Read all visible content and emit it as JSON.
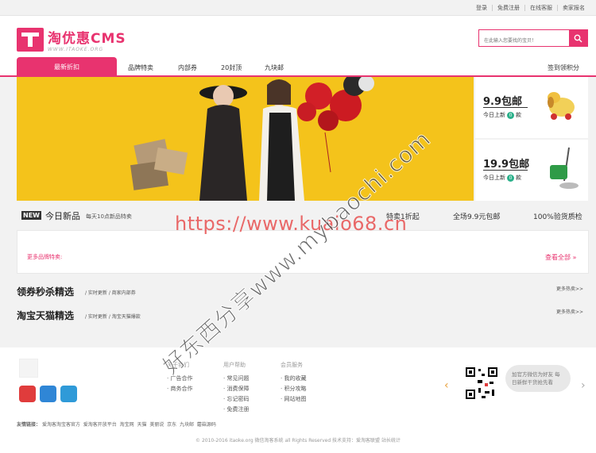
{
  "topbar": {
    "links": [
      "登录",
      "免费注册",
      "在线客服",
      "卖家报名"
    ]
  },
  "logo": {
    "title": "淘优惠CMS",
    "subtitle": "WWW.ITAOKE.ORG"
  },
  "search": {
    "placeholder": "在此输入您要找的宝贝！"
  },
  "nav": {
    "active": "最新折扣",
    "items": [
      "品牌特卖",
      "内部券",
      "20封顶",
      "九块邮"
    ],
    "right": "签到领积分"
  },
  "side": [
    {
      "price": "9.9包邮",
      "sub": "今日上新",
      "count": "0",
      "unit": "款"
    },
    {
      "price": "19.9包邮",
      "sub": "今日上新",
      "count": "0",
      "unit": "款"
    }
  ],
  "strip": {
    "badge": "NEW",
    "title": "今日新品",
    "sub": "每天10点新品特卖",
    "features": [
      "特卖1折起",
      "全场9.9元包邮",
      "100%验货质检"
    ]
  },
  "brand_panel": {
    "left": "更多品牌特卖:",
    "right": "查看全部 »"
  },
  "sections": [
    {
      "title": "领券秒杀精选",
      "sub": "/ 实时更新 / 商家内部券",
      "more": "更多热卖>>"
    },
    {
      "title": "淘宝天猫精选",
      "sub": "/ 实时更新 / 淘宝天猫爆款",
      "more": "更多热卖>>"
    }
  ],
  "footer": {
    "cols": [
      {
        "head": "关于我们",
        "items": [
          "广告合作",
          "商务合作"
        ]
      },
      {
        "head": "用户帮助",
        "items": [
          "常见问题",
          "消费保障",
          "忘记密码",
          "免费注册"
        ]
      },
      {
        "head": "会员服务",
        "items": [
          "我的收藏",
          "积分攻略",
          "网站地图"
        ]
      }
    ],
    "qr_text": "加官方微信为好友 每日新鲜干货抢先看",
    "friend_label": "友情链接：",
    "friends": [
      "爱淘客淘宝客官方",
      "爱淘客开放平台",
      "淘宝网",
      "天猫",
      "美丽说",
      "京东",
      "九块邮",
      "蘑菇源码"
    ],
    "copyright": "© 2010-2016 itaoke.org 微信淘客系统 all Rights Reserved 技术支持：爱淘客联盟 站长统计"
  },
  "watermarks": {
    "url": "https://www.kuaio68.cn",
    "diag": "好东西分享www.mybaochi.com"
  },
  "colors": {
    "accent": "#e8336f",
    "banner": "#f4c31b",
    "green": "#2ab08a"
  }
}
